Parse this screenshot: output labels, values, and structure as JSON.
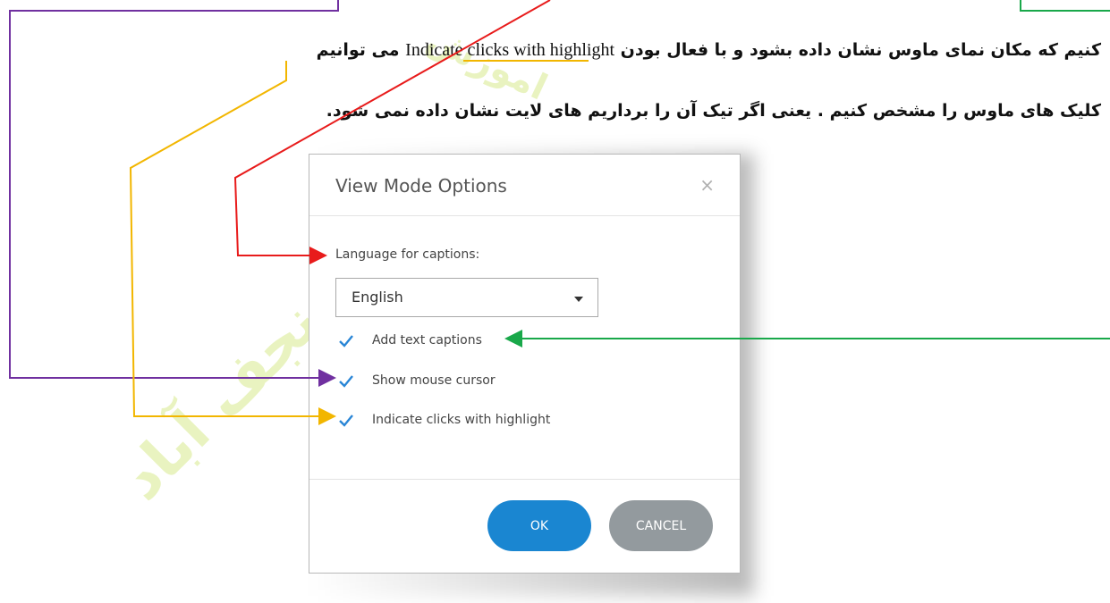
{
  "instructions": {
    "line1_part1": "کنیم که مکان نمای ماوس نشان داده بشود و با فعال بودن",
    "line1_latin": "Indicate clicks with highlight",
    "line1_part2": "می توانیم",
    "line2": "کلیک های ماوس را مشخص کنیم . یعنی اگر تیک آن را برداریم های لایت نشان داده نمی شود."
  },
  "watermark": {
    "text1": "سان نجف آباد",
    "text2": "اموزش"
  },
  "dialog": {
    "title": "View Mode Options",
    "close_glyph": "×",
    "language_label": "Language for captions:",
    "language_value": "English",
    "checkboxes": [
      {
        "label": "Add text captions",
        "checked": true
      },
      {
        "label": "Show mouse cursor",
        "checked": true
      },
      {
        "label": "Indicate clicks with highlight",
        "checked": true
      }
    ],
    "ok_label": "OK",
    "cancel_label": "CANCEL"
  },
  "colors": {
    "accent": "#1a86d1",
    "cancel": "#939a9e",
    "arrow_red": "#e81b1b",
    "arrow_purple": "#7030a0",
    "arrow_yellow": "#f2b600",
    "arrow_green": "#19a84a",
    "checkmark": "#2a86d6"
  },
  "icons": {
    "close": "close-icon",
    "dropdown": "chevron-down-icon",
    "check": "check-icon"
  }
}
